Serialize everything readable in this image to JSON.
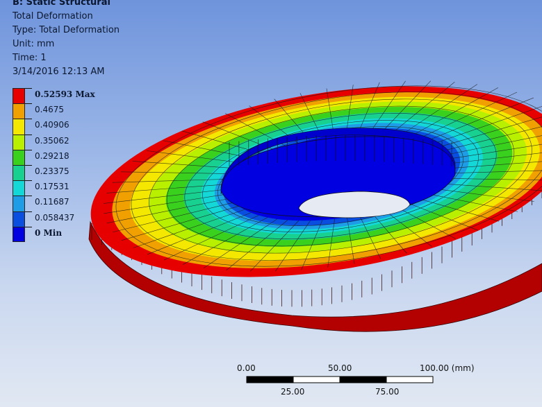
{
  "info": {
    "title": "B: Static Structural",
    "line1": "Total Deformation",
    "line2": "Type: Total Deformation",
    "line3": "Unit: mm",
    "line4": "Time: 1",
    "line5": "3/14/2016 12:13 AM"
  },
  "legend": [
    {
      "label": "0.52593 Max",
      "color": "#e60000",
      "strong": true
    },
    {
      "label": "0.4675",
      "color": "#f0a000",
      "strong": false
    },
    {
      "label": "0.40906",
      "color": "#f5e800",
      "strong": false
    },
    {
      "label": "0.35062",
      "color": "#b8f000",
      "strong": false
    },
    {
      "label": "0.29218",
      "color": "#3ad01e",
      "strong": false
    },
    {
      "label": "0.23375",
      "color": "#18d090",
      "strong": false
    },
    {
      "label": "0.17531",
      "color": "#14d8d8",
      "strong": false
    },
    {
      "label": "0.11687",
      "color": "#1e9de6",
      "strong": false
    },
    {
      "label": "0.058437",
      "color": "#0a4ee0",
      "strong": false
    },
    {
      "label": "0 Min",
      "color": "#0000e0",
      "strong": true
    }
  ],
  "scale": {
    "top_labels": [
      "0.00",
      "50.00",
      "100.00 (mm)"
    ],
    "bottom_labels": [
      "25.00",
      "75.00"
    ]
  }
}
